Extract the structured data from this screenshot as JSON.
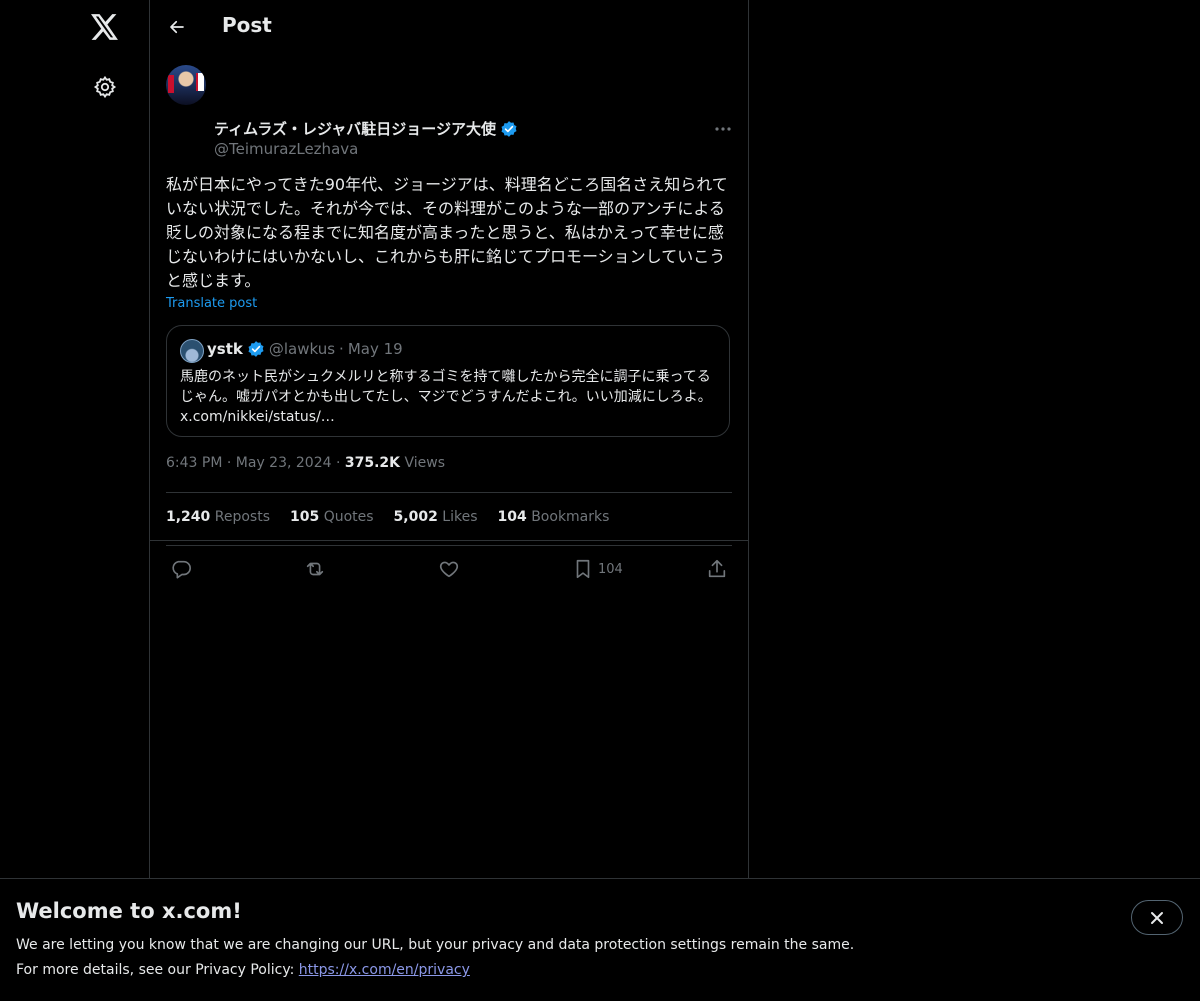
{
  "header": {
    "title": "Post"
  },
  "post": {
    "author_name": "ティムラズ・レジャバ駐日ジョージア大使",
    "author_handle": "@TeimurazLezhava",
    "text": "私が日本にやってきた90年代、ジョージアは、料理名どころ国名さえ知られていない状況でした。それが今では、その料理がこのような一部のアンチによる貶しの対象になる程までに知名度が高まったと思うと、私はかえって幸せに感じないわけにはいかないし、これからも肝に銘じてプロモーションしていこうと感じます。",
    "translate_label": "Translate post",
    "quote": {
      "name": "ystk",
      "handle": "@lawkus",
      "dot": "·",
      "date": "May 19",
      "text": "馬鹿のネット民がシュクメルリと称するゴミを持て囃したから完全に調子に乗ってるじゃん。嘘ガパオとかも出してたし、マジでどうすんだよこれ。いい加減にしろよ。 x.com/nikkei/status/…"
    },
    "time": "6:43 PM",
    "sep": "·",
    "date": "May 23, 2024",
    "views_count": "375.2K",
    "views_label": "Views",
    "stats": {
      "reposts_count": "1,240",
      "reposts_label": "Reposts",
      "quotes_count": "105",
      "quotes_label": "Quotes",
      "likes_count": "5,002",
      "likes_label": "Likes",
      "bookmarks_count": "104",
      "bookmarks_label": "Bookmarks"
    },
    "actions": {
      "bookmark_count": "104"
    }
  },
  "banner": {
    "title": "Welcome to x.com!",
    "line1": "We are letting you know that we are changing our URL, but your privacy and data protection settings remain the same.",
    "line2_prefix": "For more details, see our Privacy Policy: ",
    "link": "https://x.com/en/privacy"
  },
  "colors": {
    "background": "#000000",
    "accent": "#1d9bf0",
    "border": "#2f3336",
    "muted_text": "#71767b"
  },
  "icons": [
    "x-logo-icon",
    "gear-icon",
    "back-arrow-icon",
    "verified-badge-icon",
    "more-icon",
    "reply-icon",
    "repost-icon",
    "like-icon",
    "bookmark-icon",
    "share-icon",
    "close-icon"
  ]
}
